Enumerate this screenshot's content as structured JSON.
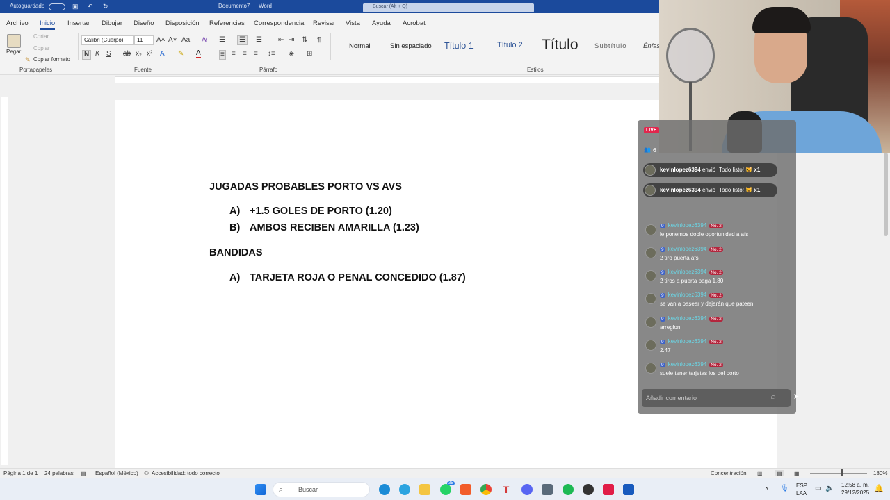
{
  "titlebar": {
    "autosave": "Autoguardado",
    "document": "Documento7",
    "app": "Word",
    "search": "Buscar (Alt + Q)"
  },
  "tabs": [
    "Archivo",
    "Inicio",
    "Insertar",
    "Dibujar",
    "Diseño",
    "Disposición",
    "Referencias",
    "Correspondencia",
    "Revisar",
    "Vista",
    "Ayuda",
    "Acrobat"
  ],
  "clipboard": {
    "paste": "Pegar",
    "cut": "Cortar",
    "copy": "Copiar",
    "format_painter": "Copiar formato",
    "group": "Portapapeles"
  },
  "font": {
    "name": "Calibri (Cuerpo)",
    "size": "11",
    "group": "Fuente"
  },
  "paragraph": {
    "group": "Párrafo"
  },
  "styles": {
    "items": [
      "Normal",
      "Sin espaciado",
      "Título 1",
      "Título 2",
      "Título",
      "Subtítulo",
      "Énfas"
    ],
    "group": "Estilos"
  },
  "document": {
    "title": "JUGADAS PROBABLES PORTO VS AVS",
    "list1": [
      {
        "marker": "A)",
        "text": "+1.5 GOLES DE PORTO (1.20)"
      },
      {
        "marker": "B)",
        "text": "AMBOS RECIBEN AMARILLA (1.23)"
      }
    ],
    "heading2": "BANDIDAS",
    "list2": [
      {
        "marker": "A)",
        "text": "TARJETA ROJA O PENAL CONCEDIDO (1.87)"
      }
    ]
  },
  "status": {
    "page": "Página 1 de 1",
    "words": "24 palabras",
    "language": "Español (México)",
    "accessibility": "Accesibilidad: todo correcto",
    "focus": "Concentración",
    "zoom": "180%"
  },
  "taskbar": {
    "search": "Buscar",
    "lang": "ESP",
    "layout": "LAA",
    "time": "12:58 a. m.",
    "date": "29/12/2025",
    "whatsapp_badge": "35"
  },
  "live": {
    "badge": "LIVE",
    "viewers": "6",
    "gifts": [
      {
        "user": "kevinlopez6394",
        "action": "envió ¡Todo listo!",
        "count": "x1"
      },
      {
        "user": "kevinlopez6394",
        "action": "envió ¡Todo listo!",
        "count": "x1"
      }
    ],
    "comments": [
      {
        "user": "kevinlopez6394",
        "level": "9",
        "rank": "No. 2",
        "text": "le ponemos doble oportunidad a afs"
      },
      {
        "user": "kevinlopez6394",
        "level": "9",
        "rank": "No. 2",
        "text": "2 tiro puerta afs"
      },
      {
        "user": "kevinlopez6394",
        "level": "9",
        "rank": "No. 2",
        "text": "2 tiros a puerta paga 1.80"
      },
      {
        "user": "kevinlopez6394",
        "level": "9",
        "rank": "No. 2",
        "text": "se van a pasear y dejarán que pateen"
      },
      {
        "user": "kevinlopez6394",
        "level": "9",
        "rank": "No. 2",
        "text": "arreglon"
      },
      {
        "user": "kevinlopez6394",
        "level": "9",
        "rank": "No. 2",
        "text": "2.47"
      },
      {
        "user": "kevinlopez6394",
        "level": "9",
        "rank": "No. 2",
        "text": "suele tener tarjetas los del porto"
      }
    ],
    "input_placeholder": "Añadir comentario"
  },
  "colors": {
    "word_blue": "#1b4a9c",
    "live_red": "#e2264d",
    "username_cyan": "#6ad6e6"
  }
}
